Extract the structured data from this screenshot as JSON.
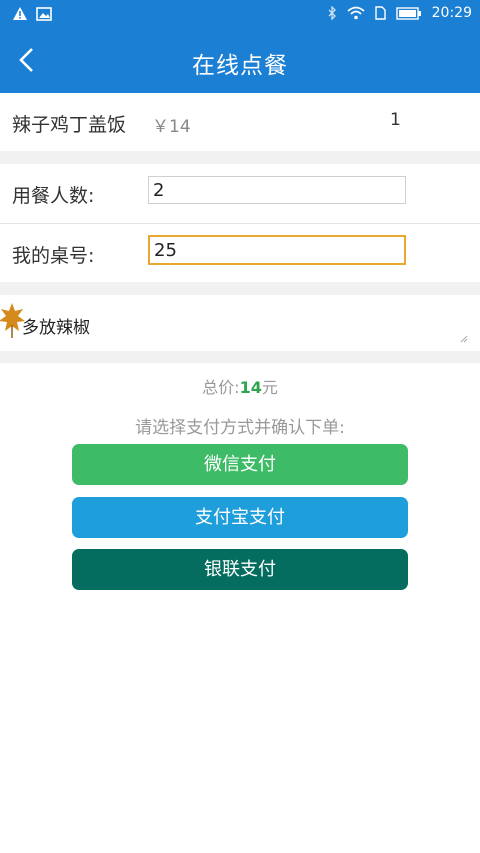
{
  "status_bar": {
    "time": "20:29",
    "colors": {
      "background": "#1b7fd3"
    },
    "icons": [
      "warning-icon",
      "image-icon",
      "bluetooth-icon",
      "wifi-icon",
      "sim-icon",
      "battery-icon"
    ]
  },
  "app_bar": {
    "title": "在线点餐",
    "back_icon": "chevron-left-icon"
  },
  "order_item": {
    "name": "辣子鸡丁盖饭",
    "price": "￥14",
    "quantity": "1"
  },
  "form": {
    "diners_label": "用餐人数:",
    "diners_value": "2",
    "table_label": "我的桌号:",
    "table_value": "25"
  },
  "note": {
    "text": "多放辣椒"
  },
  "summary": {
    "total_label": "总价:",
    "total_amount": "14",
    "total_unit": "元",
    "hint": "请选择支付方式并确认下单:"
  },
  "payment": {
    "wechat_label": "微信支付",
    "alipay_label": "支付宝支付",
    "unionpay_label": "银联支付",
    "colors": {
      "wechat": "#3dbb67",
      "alipay": "#1f9edc",
      "unionpay": "#046d5f"
    }
  }
}
